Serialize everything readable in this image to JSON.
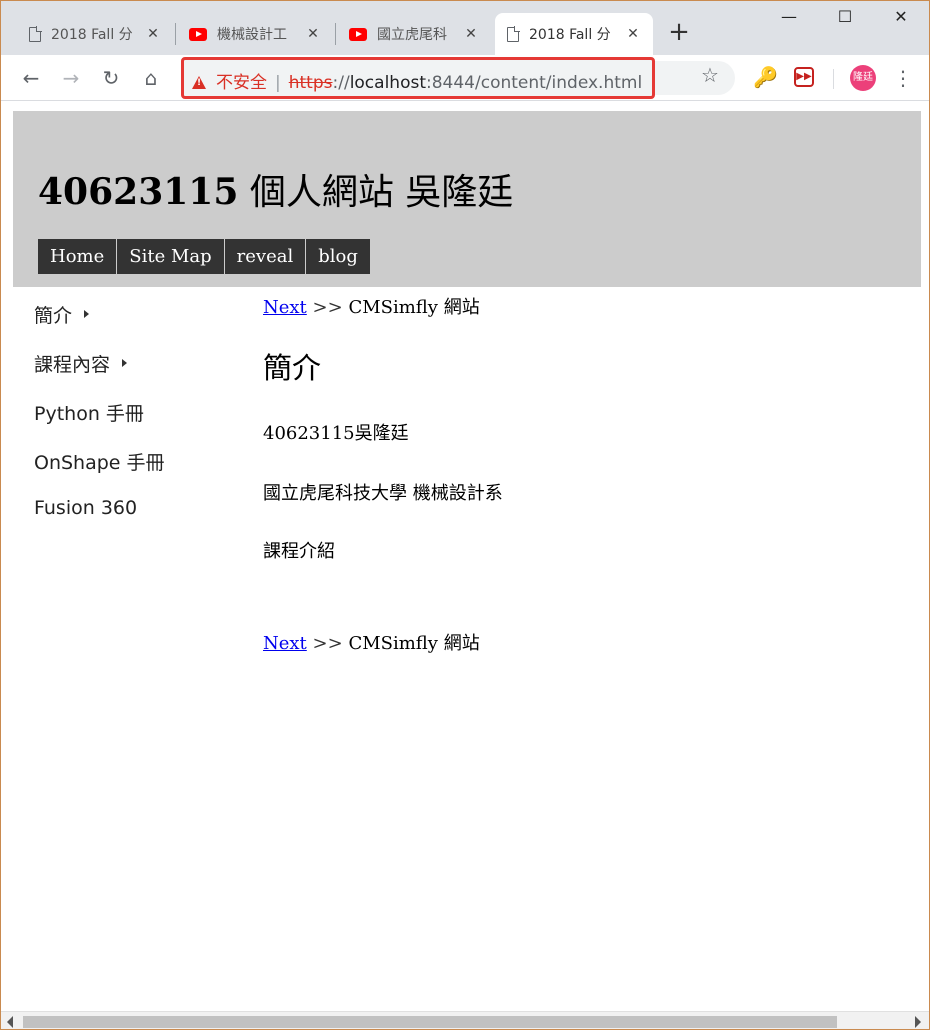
{
  "browser": {
    "tabs": [
      {
        "title": "2018 Fall 分",
        "icon": "doc-icon",
        "active": false
      },
      {
        "title": "機械設計工",
        "icon": "youtube-icon",
        "active": false
      },
      {
        "title": "國立虎尾科",
        "icon": "youtube-icon",
        "active": false
      },
      {
        "title": "2018 Fall 分",
        "icon": "doc-icon",
        "active": true
      }
    ],
    "new_tab_label": "+",
    "window_controls": {
      "minimize": "—",
      "maximize": "☐",
      "close": "✕"
    },
    "toolbar": {
      "back": "←",
      "forward": "→",
      "reload": "↻",
      "home": "⌂",
      "insecure_label": "不安全",
      "url_scheme": "https",
      "url_sep": "://",
      "url_host": "localhost",
      "url_rest": ":8444/content/index.html",
      "star": "☆",
      "avatar_label": "隆廷",
      "menu": "⋮"
    }
  },
  "site": {
    "title_number": "40623115",
    "title_text": " 個人網站 吳隆廷",
    "nav": [
      "Home",
      "Site Map",
      "reveal",
      "blog"
    ]
  },
  "sidebar": {
    "items": [
      {
        "label": "簡介",
        "has_arrow": true
      },
      {
        "label": "課程內容",
        "has_arrow": true
      },
      {
        "label": "Python 手冊",
        "has_arrow": false
      },
      {
        "label": "OnShape 手冊",
        "has_arrow": false
      },
      {
        "label": "Fusion 360",
        "has_arrow": false
      }
    ]
  },
  "main": {
    "next_link": "Next",
    "crumb_sep": ">>",
    "crumb_text": "CMSimfly 網站",
    "heading": "簡介",
    "paragraphs": [
      "40623115吳隆廷",
      "國立虎尾科技大學 機械設計系",
      "課程介紹"
    ]
  },
  "colors": {
    "header_bg": "#cccccc",
    "nav_bg": "#333333",
    "link": "#0000ee",
    "warning": "#d93025",
    "highlight_border": "#e53935"
  }
}
